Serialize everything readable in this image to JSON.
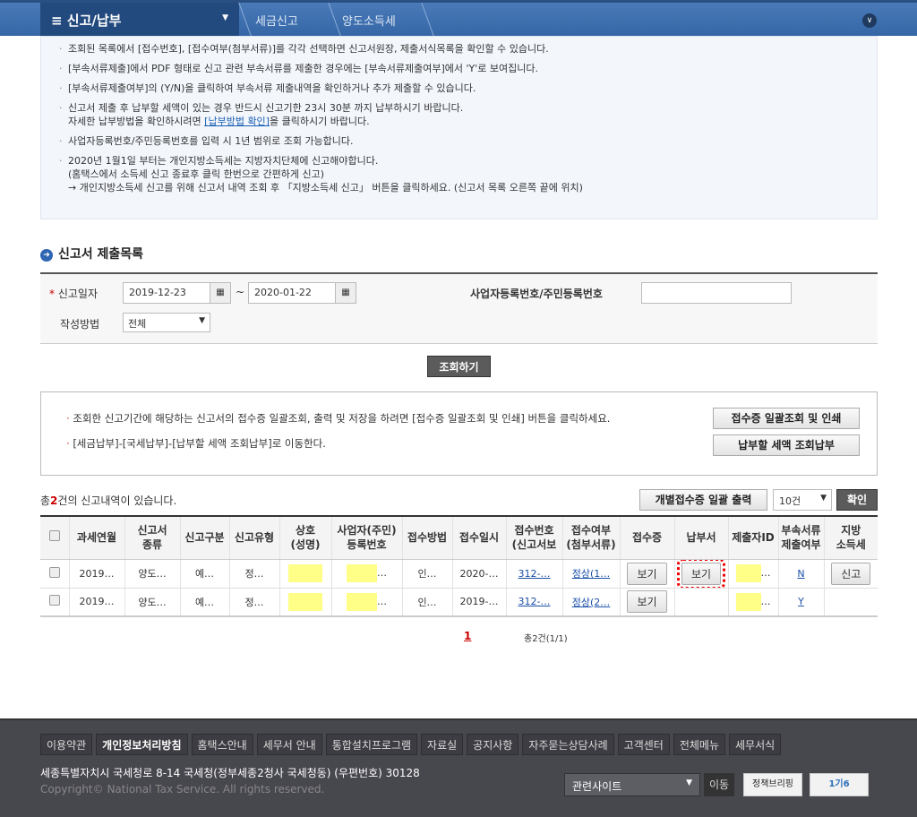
{
  "header": {
    "menu": "신고/납부",
    "crumbs": [
      "세금신고",
      "양도소득세"
    ]
  },
  "info": {
    "lines": [
      "조회된 목록에서 [접수번호], [접수여부(첨부서류)]를 각각 선택하면 신고서원장, 제출서식목록을 확인할 수 있습니다.",
      "[부속서류제출]에서 PDF 형태로 신고 관련 부속서류를 제출한 경우에는 [부속서류제출여부]에서 'Y'로 보여집니다.",
      "[부속서류제출여부]의 (Y/N)을 클릭하여 부속서류 제출내역을 확인하거나 추가 제출할 수 있습니다.",
      "신고서 제출 후 납부할 세액이 있는 경우 반드시 신고기한 23시 30분 까지 납부하시기 바랍니다."
    ],
    "line4b_pre": "자세한 납부방법을 확인하시려면 ",
    "line4b_link": "[납부방법 확인]",
    "line4b_post": "을 클릭하시기 바랍니다.",
    "line5": "사업자등록번호/주민등록번호를 입력 시 1년 범위로 조회 가능합니다.",
    "line6": "2020년 1월1일 부터는 개인지방소득세는 지방자치단체에 신고해야합니다.",
    "line6b": "(홈택스에서 소득세 신고 종료후 클릭 한번으로 간편하게 신고)",
    "line6c": "→ 개인지방소득세 신고를 위해 신고서 내역 조회 후 「지방소득세 신고」 버튼을 클릭하세요. (신고서 목록 오른쪽 끝에 위치)"
  },
  "section_title": "신고서 제출목록",
  "search": {
    "date_label": "신고일자",
    "date_from": "2019-12-23",
    "date_to": "2020-01-22",
    "tilde": "~",
    "id_label": "사업자등록번호/주민등록번호",
    "id_value": "",
    "method_label": "작성방법",
    "method_value": "전체",
    "submit": "조회하기"
  },
  "notice": {
    "line1": "조회한 신고기간에 해당하는 신고서의 접수증 일괄조회, 출력 및 저장을 하려면 [접수증 일괄조회 및 인쇄] 버튼을 클릭하세요.",
    "line2": "[세금납부]-[국세납부]-[납부할 세액 조회납부]로 이동한다.",
    "btn1": "접수증 일괄조회 및 인쇄",
    "btn2": "납부할 세액 조회납부"
  },
  "list": {
    "count_pre": "총",
    "count": "2",
    "count_post": "건의 신고내역이 있습니다.",
    "bulk_print": "개별접수증 일괄 출력",
    "page_size": "10건",
    "confirm": "확인"
  },
  "table": {
    "headers": [
      "",
      "과세연월",
      "신고서\n종류",
      "신고구분",
      "신고유형",
      "상호\n(성명)",
      "사업자(주민)\n등록번호",
      "접수방법",
      "접수일시",
      "접수번호\n(신고서보",
      "접수여부\n(첨부서류)",
      "접수증",
      "납부서",
      "제출자ID",
      "부속서류\n제출여부",
      "지방\n소득세"
    ],
    "rows": [
      [
        "",
        "2019…",
        "양도…",
        "예…",
        "정…",
        "",
        "…",
        "인…",
        "2020-…",
        "312-…",
        "정상(1…",
        "보기",
        "보기",
        "…",
        "N",
        "신고"
      ],
      [
        "",
        "2019…",
        "양도…",
        "예…",
        "정…",
        "",
        "…",
        "인…",
        "2019-…",
        "312-…",
        "정상(2…",
        "보기",
        "",
        "…",
        "Y",
        ""
      ]
    ]
  },
  "pagination": {
    "current": "1",
    "summary": "총2건(1/1)"
  },
  "footer": {
    "links": [
      "이용약관",
      "개인정보처리방침",
      "홈택스안내",
      "세무서 안내",
      "통합설치프로그램",
      "자료실",
      "공지사항",
      "자주묻는상담사례",
      "고객센터",
      "전체메뉴",
      "세무서식"
    ],
    "address": "세종특별자치시 국세청로 8-14 국세청(정부세종2청사 국세청동) (우편번호) 30128",
    "copyright": "Copyright© National Tax Service. All rights reserved.",
    "related": "관련사이트",
    "go": "이동",
    "banner1": "정책브리핑",
    "banner2": "1기6"
  }
}
